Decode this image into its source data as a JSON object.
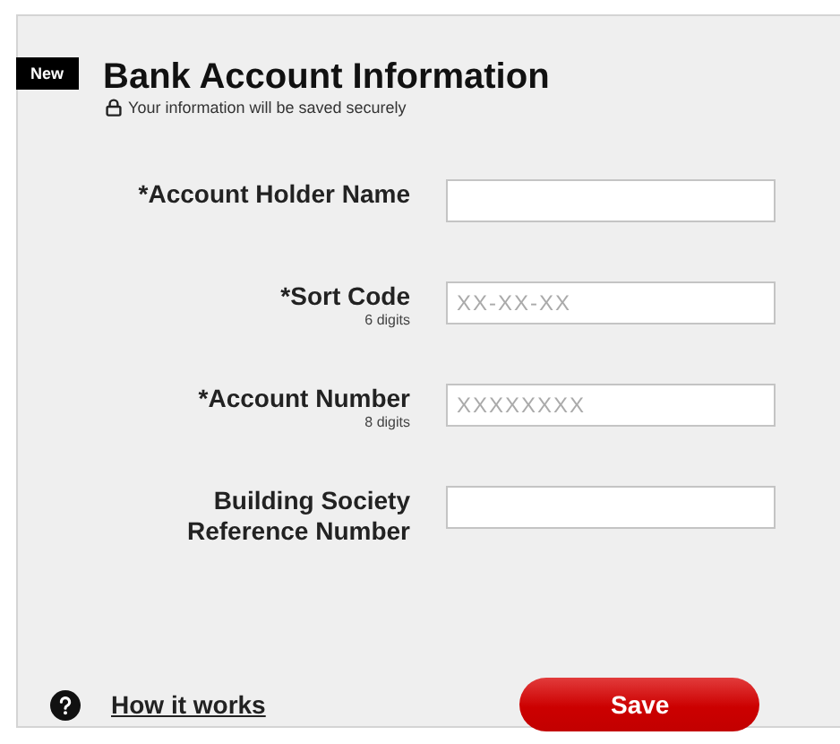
{
  "badge": "New",
  "title": "Bank Account Information",
  "subtitle": "Your information will be saved securely",
  "fields": [
    {
      "label": "*Account Holder Name"
    },
    {
      "label": "*Sort Code",
      "hint": "6 digits",
      "placeholder": "XX-XX-XX"
    },
    {
      "label": "*Account Number",
      "hint": "8 digits",
      "placeholder": "XXXXXXXX"
    },
    {
      "label": "Building  Society Reference Number"
    }
  ],
  "help_link": "How it works",
  "save_button": "Save"
}
